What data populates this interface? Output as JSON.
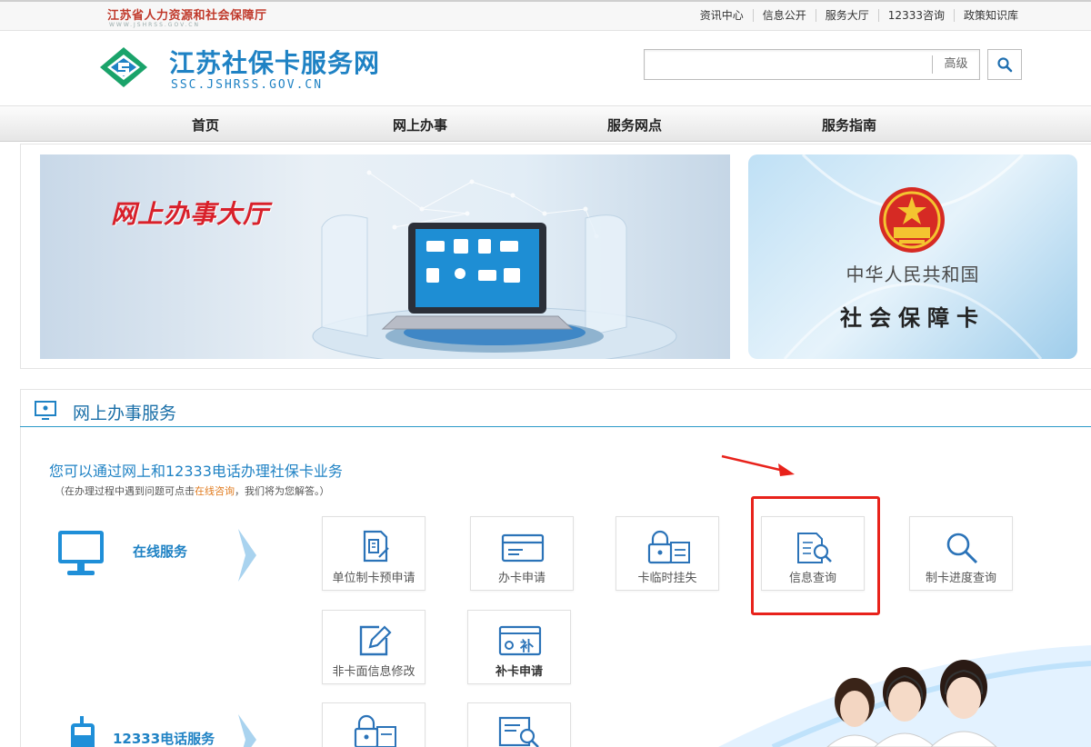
{
  "topbar": {
    "department": "江苏省人力资源和社会保障厅",
    "department_url": "WWW.JSHRSS.GOV.CN",
    "links": [
      "资讯中心",
      "信息公开",
      "服务大厅",
      "12333咨询",
      "政策知识库"
    ]
  },
  "header": {
    "site_title": "江苏社保卡服务网",
    "site_domain": "SSC.JSHRSS.GOV.CN",
    "search_value": "",
    "advanced_label": "高级"
  },
  "nav": {
    "items": [
      "首页",
      "网上办事",
      "服务网点",
      "服务指南"
    ]
  },
  "banner": {
    "hall_text": "网上办事大厅",
    "card_country": "中华人民共和国",
    "card_name": "社会保障卡"
  },
  "service": {
    "title": "网上办事服务",
    "intro": "您可以通过网上和12333电话办理社保卡业务",
    "note_prefix": "（在办理过程中遇到问题可点击",
    "note_link": "在线咨询",
    "note_suffix": "，我们将为您解答。）",
    "online_label": "在线服务",
    "phone_label": "12333电话服务",
    "tiles": [
      {
        "label": "单位制卡预申请",
        "icon": "building-form-icon"
      },
      {
        "label": "办卡申请",
        "icon": "card-icon"
      },
      {
        "label": "卡临时挂失",
        "icon": "lock-card-icon"
      },
      {
        "label": "信息查询",
        "icon": "document-search-icon"
      },
      {
        "label": "制卡进度查询",
        "icon": "magnifier-icon"
      },
      {
        "label": "非卡面信息修改",
        "icon": "edit-icon"
      },
      {
        "label": "补卡申请",
        "icon": "reissue-card-icon"
      }
    ],
    "reissue_badge": "补"
  },
  "colors": {
    "brand_blue": "#1f82c4",
    "highlight_red": "#e8221b",
    "banner_red": "#d8202a"
  }
}
